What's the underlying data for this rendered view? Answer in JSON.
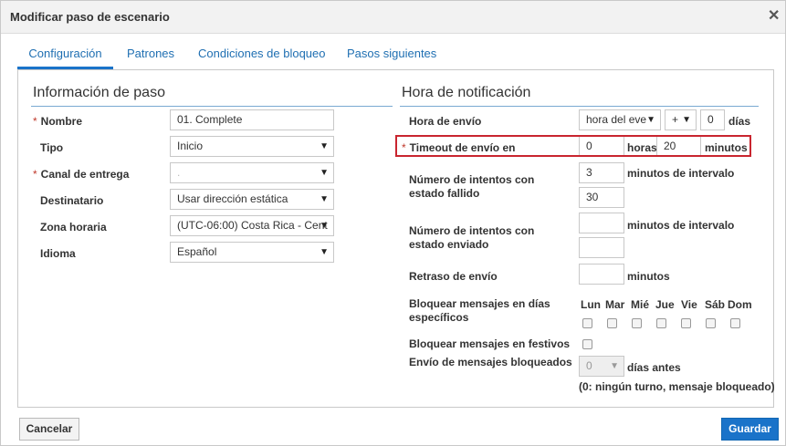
{
  "dialog": {
    "title": "Modificar paso de escenario",
    "close_glyph": "✕"
  },
  "tabs": [
    {
      "label": "Configuración",
      "active": true
    },
    {
      "label": "Patrones"
    },
    {
      "label": "Condiciones de bloqueo"
    },
    {
      "label": "Pasos siguientes"
    }
  ],
  "step_info": {
    "title": "Información de paso",
    "name": {
      "label": "Nombre",
      "required": "*",
      "value": "01. Complete"
    },
    "type": {
      "label": "Tipo",
      "value": "Inicio"
    },
    "channel": {
      "label": "Canal de entrega",
      "required": "*",
      "value": "."
    },
    "recipient": {
      "label": "Destinatario",
      "value": "Usar dirección estática"
    },
    "timezone": {
      "label": "Zona horaria",
      "value": "(UTC-06:00) Costa Rica - Cent"
    },
    "language": {
      "label": "Idioma",
      "value": "Español"
    }
  },
  "notify": {
    "title": "Hora de notificación",
    "send_time": {
      "label": "Hora de envío",
      "event": "hora del eve",
      "sign": "+",
      "days_value": "0",
      "days_label": "días"
    },
    "timeout": {
      "required": "*",
      "label": "Timeout de envío en",
      "hours_value": "0",
      "hours_label": "horas",
      "minutes_value": "20",
      "minutes_label": "minutos"
    },
    "failed_attempts": {
      "label": "Número de intentos con estado fallido",
      "count": "3",
      "interval_label": "minutos de intervalo",
      "interval": "30"
    },
    "sent_attempts": {
      "label": "Número de intentos con estado enviado",
      "count": "",
      "interval_label": "minutos de intervalo",
      "interval": ""
    },
    "delay": {
      "label": "Retraso de envío",
      "value": "",
      "unit": "minutos"
    },
    "block_days": {
      "label": "Bloquear mensajes en días específicos",
      "days": [
        "Lun",
        "Mar",
        "Mié",
        "Jue",
        "Vie",
        "Sáb",
        "Dom"
      ]
    },
    "block_holidays": {
      "label": "Bloquear mensajes en festivos"
    },
    "send_blocked": {
      "label": "Envío de mensajes bloqueados",
      "value": "0",
      "unit": "días antes",
      "note": "(0: ningún turno, mensaje bloqueado)"
    }
  },
  "footer": {
    "cancel": "Cancelar",
    "save": "Guardar"
  },
  "colors": {
    "accent": "#1a73c9",
    "highlight": "#c9252f",
    "required": "#c0392b"
  }
}
